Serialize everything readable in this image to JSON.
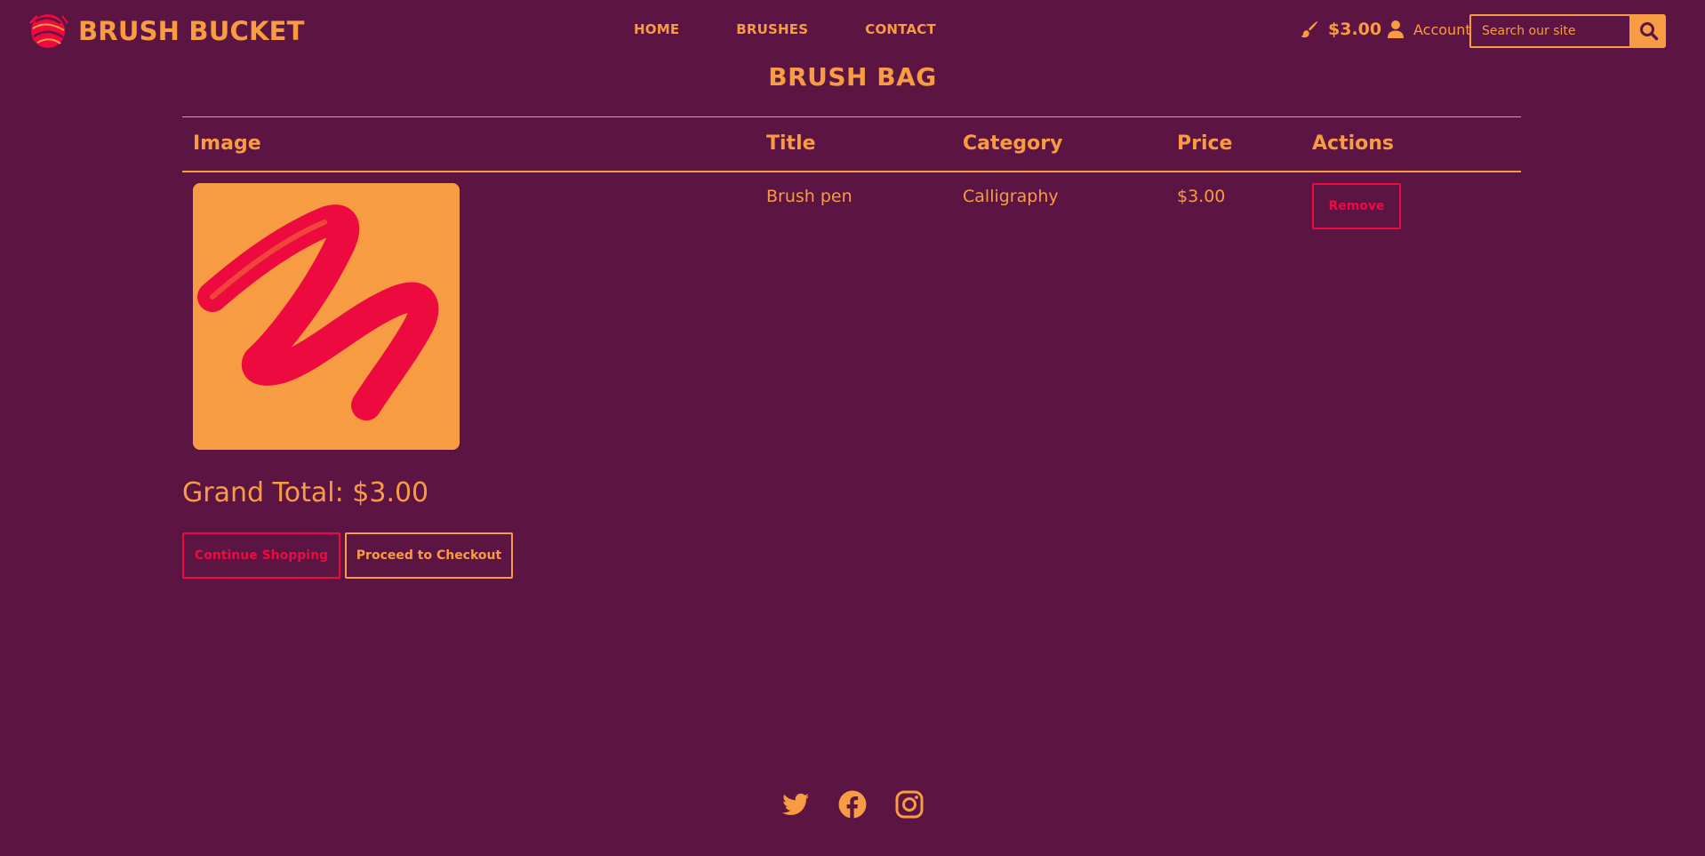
{
  "colors": {
    "background": "#5c1542",
    "accent": "#f79c42",
    "danger": "#ec0a3e"
  },
  "header": {
    "logo_text": "BRUSH BUCKET",
    "nav": [
      {
        "label": "HOME"
      },
      {
        "label": "BRUSHES"
      },
      {
        "label": "CONTACT"
      }
    ],
    "cart_total": "$3.00",
    "cart_icon": "paintbrush-icon",
    "account_label": "Account",
    "account_icon": "user-icon",
    "search_placeholder": "Search our site",
    "search_icon": "magnifier-icon"
  },
  "page_title": "BRUSH BAG",
  "table": {
    "headers": {
      "image": "Image",
      "title": "Title",
      "category": "Category",
      "price": "Price",
      "actions": "Actions"
    },
    "rows": [
      {
        "image": "brush-stroke-image",
        "title": "Brush pen",
        "category": "Calligraphy",
        "price": "$3.00",
        "action_label": "Remove"
      }
    ]
  },
  "grand_total": "Grand Total: $3.00",
  "buttons": {
    "continue_label": "Continue Shopping",
    "checkout_label": "Proceed to Checkout"
  },
  "footer": {
    "social_icons": [
      "twitter-icon",
      "facebook-icon",
      "instagram-icon"
    ]
  }
}
